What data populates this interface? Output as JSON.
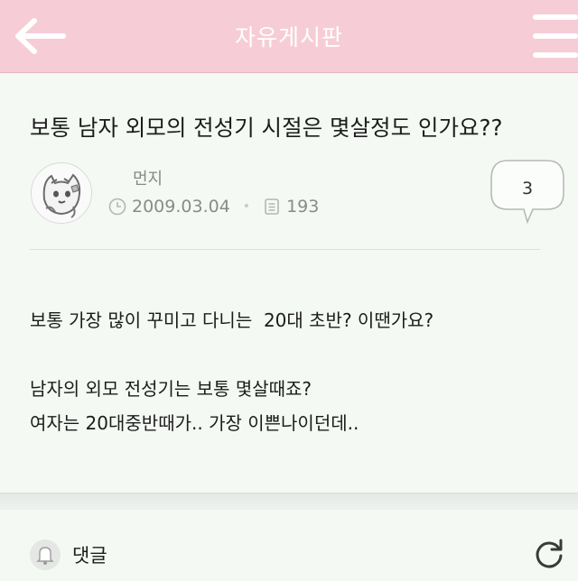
{
  "header": {
    "title": "자유게시판",
    "back_icon": "back-arrow-icon",
    "menu_icon": "hamburger-menu-icon",
    "background": "#f6cdd7"
  },
  "post": {
    "title": "보통 남자 외모의 전성기 시절은 몇살정도 인가요??",
    "author": "먼지",
    "date": "2009.03.04",
    "views": "193",
    "comment_count": "3",
    "body": [
      "보통 가장 많이 꾸미고 다니는  20대 초반? 이땐가요?",
      "",
      "남자의 외모 전성기는 보통 몇살때죠?",
      "여자는 20대중반때가.. 가장 이쁜나이던데.."
    ]
  },
  "comments": {
    "label": "댓글",
    "refresh_icon": "refresh-icon",
    "bell_icon": "bell-icon"
  }
}
